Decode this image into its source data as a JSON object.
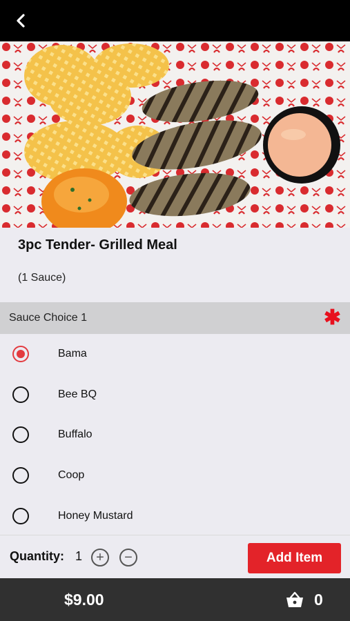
{
  "header": {
    "back_icon": "chevron-left-icon"
  },
  "item": {
    "title": "3pc Tender- Grilled Meal",
    "description": "(1 Sauce)"
  },
  "modifier_group": {
    "label": "Sauce Choice 1",
    "required_marker": "✱",
    "options": [
      {
        "label": "Bama",
        "selected": true
      },
      {
        "label": "Bee BQ",
        "selected": false
      },
      {
        "label": "Buffalo",
        "selected": false
      },
      {
        "label": "Coop",
        "selected": false
      },
      {
        "label": "Honey Mustard",
        "selected": false
      }
    ]
  },
  "quantity": {
    "label": "Quantity:",
    "value": "1",
    "plus_symbol": "+",
    "minus_symbol": "−"
  },
  "add_button_label": "Add Item",
  "footer": {
    "price": "$9.00",
    "cart_count": "0",
    "cart_icon": "basket-icon"
  },
  "colors": {
    "accent_red": "#e32329",
    "radio_selected": "#e33a3f",
    "bottom_bar": "#303030",
    "section_header": "#d0d0d2"
  }
}
